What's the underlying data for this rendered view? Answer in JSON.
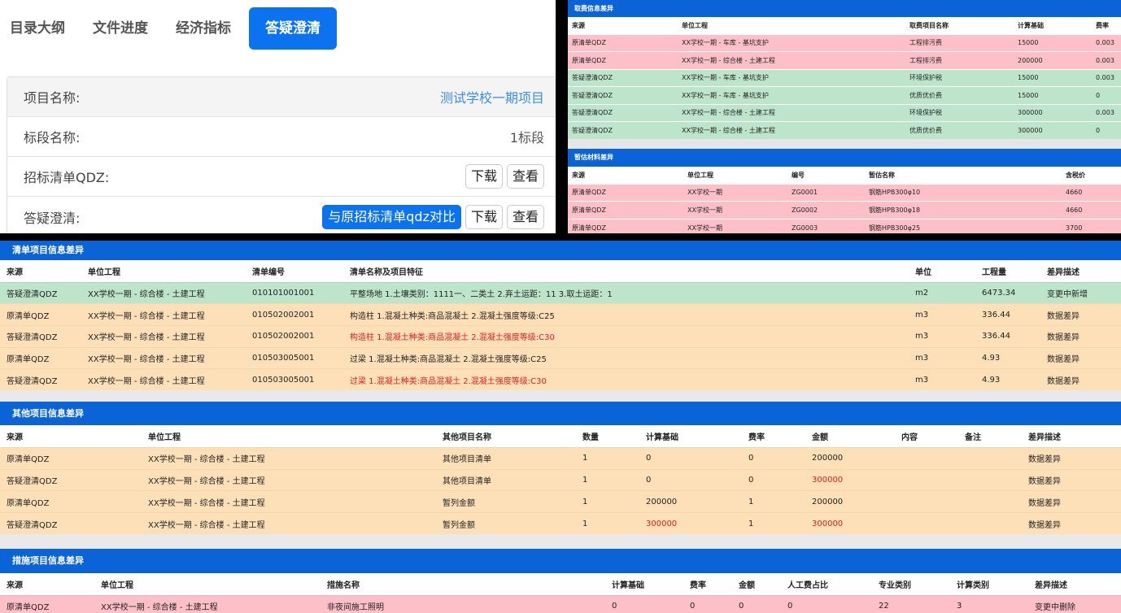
{
  "tabs": [
    "目录大纲",
    "文件进度",
    "经济指标",
    "答疑澄清"
  ],
  "info": {
    "project_label": "项目名称:",
    "project_value": "测试学校一期项目",
    "section_label": "标段名称:",
    "section_value": "1标段",
    "bid_label": "招标清单QDZ:",
    "qa_label": "答疑澄清:",
    "compare_btn": "与原招标清单qdz对比",
    "download_btn": "下载",
    "view_btn": "查看"
  },
  "fee": {
    "title": "取费信息差异",
    "headers": [
      "来源",
      "单位工程",
      "取费项目名称",
      "计算基础",
      "费率"
    ],
    "rows": [
      {
        "style": "pink",
        "cells": [
          "原清单QDZ",
          "XX学校一期 - 车库 - 基坑支护",
          "工程排污费",
          "15000",
          "0.003"
        ]
      },
      {
        "style": "pink",
        "cells": [
          "原清单QDZ",
          "XX学校一期 - 综合楼 - 土建工程",
          "工程排污费",
          "200000",
          "0.003"
        ]
      },
      {
        "style": "green",
        "cells": [
          "答疑澄清QDZ",
          "XX学校一期 - 车库 - 基坑支护",
          "环境保护税",
          "15000",
          "0.003"
        ]
      },
      {
        "style": "green",
        "cells": [
          "答疑澄清QDZ",
          "XX学校一期 - 车库 - 基坑支护",
          "优质优价费",
          "15000",
          "0"
        ]
      },
      {
        "style": "green",
        "cells": [
          "答疑澄清QDZ",
          "XX学校一期 - 综合楼 - 土建工程",
          "环境保护税",
          "300000",
          "0.003"
        ]
      },
      {
        "style": "green",
        "cells": [
          "答疑澄清QDZ",
          "XX学校一期 - 综合楼 - 土建工程",
          "优质优价费",
          "300000",
          "0"
        ]
      }
    ]
  },
  "material": {
    "title": "暂估材料差异",
    "headers": [
      "来源",
      "单位工程",
      "编号",
      "暂估名称",
      "含税价"
    ],
    "rows": [
      {
        "style": "pink",
        "cells": [
          "原清单QDZ",
          "XX学校一期",
          "ZG0001",
          "钢筋HPB300φ10",
          "4660"
        ]
      },
      {
        "style": "pink",
        "cells": [
          "原清单QDZ",
          "XX学校一期",
          "ZG0002",
          "钢筋HPB300φ18",
          "4660"
        ]
      },
      {
        "style": "pink",
        "cells": [
          "原清单QDZ",
          "XX学校一期",
          "ZG0003",
          "钢筋HPB300φ25",
          "3700"
        ]
      }
    ]
  },
  "bill": {
    "title": "清单项目信息差异",
    "headers": [
      "来源",
      "单位工程",
      "清单编号",
      "清单名称及项目特征",
      "单位",
      "工程量",
      "差异描述"
    ],
    "rows": [
      {
        "style": "green",
        "red": false,
        "cells": [
          "答疑澄清QDZ",
          "XX学校一期 - 综合楼 - 土建工程",
          "010101001001",
          "平整场地 1.土壤类别：1111一、二类土 2.弃土运距：11 3.取土运距：1",
          "m2",
          "6473.34",
          "变更中新增"
        ]
      },
      {
        "style": "orange",
        "red": false,
        "cells": [
          "原清单QDZ",
          "XX学校一期 - 综合楼 - 土建工程",
          "010502002001",
          "构造柱 1.混凝土种类:商品混凝土 2.混凝土强度等级:C25",
          "m3",
          "336.44",
          "数据差异"
        ]
      },
      {
        "style": "orange",
        "red": true,
        "cells": [
          "答疑澄清QDZ",
          "XX学校一期 - 综合楼 - 土建工程",
          "010502002001",
          "构造柱 1.混凝土种类:商品混凝土 2.混凝土强度等级:C30",
          "m3",
          "336.44",
          "数据差异"
        ]
      },
      {
        "style": "orange",
        "red": false,
        "cells": [
          "原清单QDZ",
          "XX学校一期 - 综合楼 - 土建工程",
          "010503005001",
          "过梁 1.混凝土种类:商品混凝土 2.混凝土强度等级:C25",
          "m3",
          "4.93",
          "数据差异"
        ]
      },
      {
        "style": "orange",
        "red": true,
        "cells": [
          "答疑澄清QDZ",
          "XX学校一期 - 综合楼 - 土建工程",
          "010503005001",
          "过梁 1.混凝土种类:商品混凝土 2.混凝土强度等级:C30",
          "m3",
          "4.93",
          "数据差异"
        ]
      }
    ]
  },
  "other": {
    "title": "其他项目信息差异",
    "headers": [
      "来源",
      "单位工程",
      "其他项目名称",
      "数量",
      "计算基础",
      "费率",
      "金额",
      "内容",
      "备注",
      "差异描述"
    ],
    "rows": [
      {
        "style": "orange",
        "redcols": [],
        "cells": [
          "原清单QDZ",
          "XX学校一期 - 综合楼 - 土建工程",
          "其他项目清单",
          "1",
          "0",
          "0",
          "200000",
          "",
          "",
          "数据差异"
        ]
      },
      {
        "style": "orange",
        "redcols": [
          6
        ],
        "cells": [
          "答疑澄清QDZ",
          "XX学校一期 - 综合楼 - 土建工程",
          "其他项目清单",
          "1",
          "0",
          "0",
          "300000",
          "",
          "",
          "数据差异"
        ]
      },
      {
        "style": "orange",
        "redcols": [],
        "cells": [
          "原清单QDZ",
          "XX学校一期 - 综合楼 - 土建工程",
          "暂列金额",
          "1",
          "200000",
          "1",
          "200000",
          "",
          "",
          "数据差异"
        ]
      },
      {
        "style": "orange",
        "redcols": [
          4,
          6
        ],
        "cells": [
          "答疑澄清QDZ",
          "XX学校一期 - 综合楼 - 土建工程",
          "暂列金额",
          "1",
          "300000",
          "1",
          "300000",
          "",
          "",
          "数据差异"
        ]
      }
    ]
  },
  "measure": {
    "title": "措施项目信息差异",
    "headers": [
      "来源",
      "单位工程",
      "措施名称",
      "计算基础",
      "费率",
      "金额",
      "人工费占比",
      "专业类别",
      "计算类别",
      "差异描述"
    ],
    "rows": [
      {
        "style": "pink",
        "cells": [
          "原清单QDZ",
          "XX学校一期 - 综合楼 - 土建工程",
          "非夜间施工照明",
          "0",
          "0",
          "0",
          "0",
          "22",
          "3",
          "变更中删除"
        ]
      }
    ]
  }
}
